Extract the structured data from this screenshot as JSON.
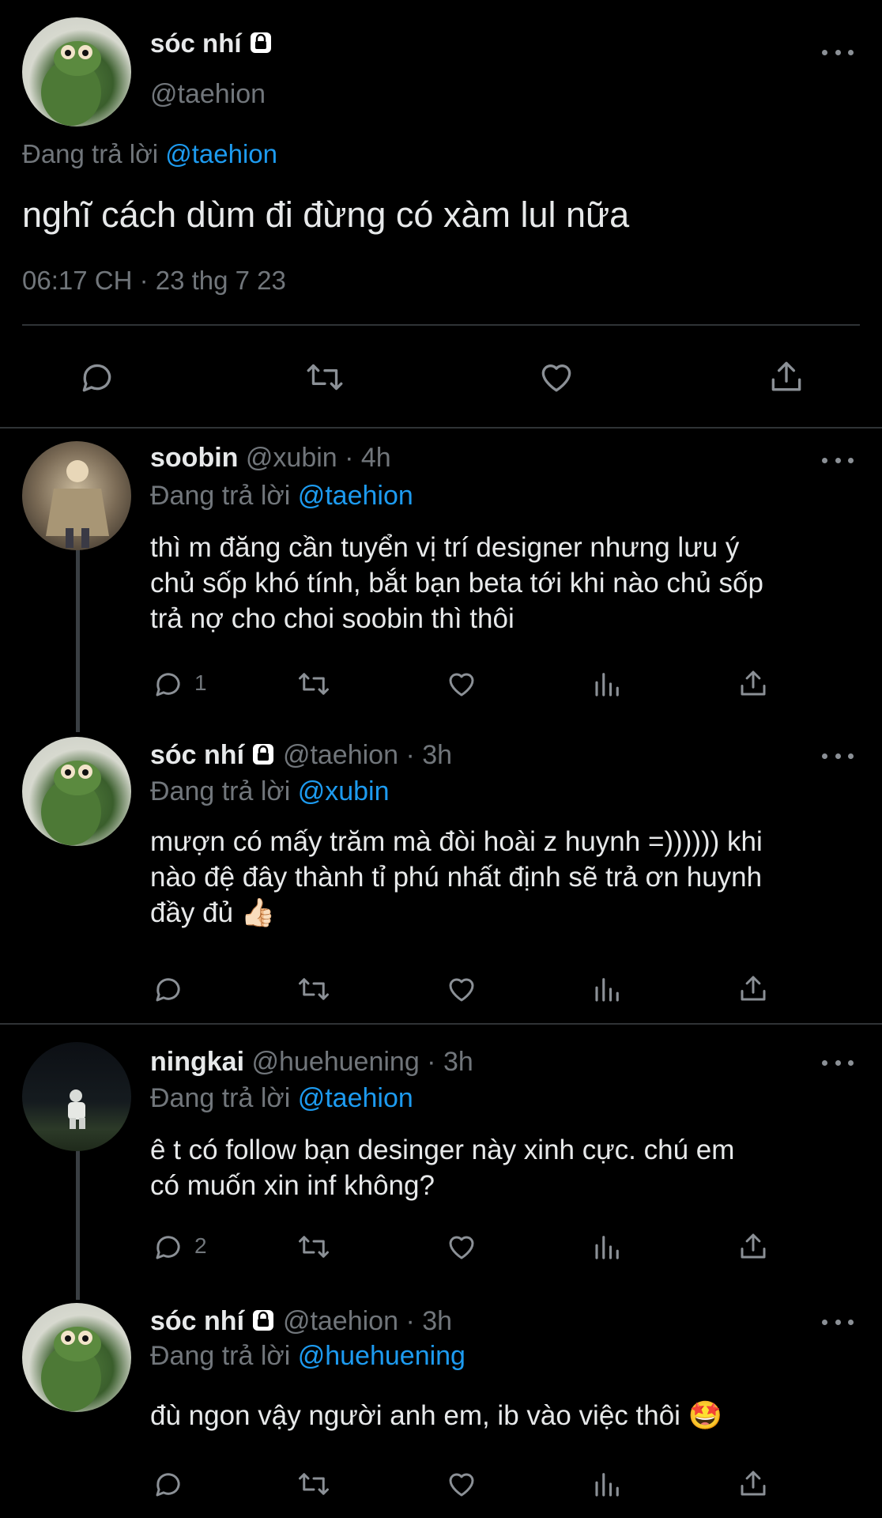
{
  "main_tweet": {
    "display_name": "sóc nhí",
    "handle": "@taehion",
    "replying_prefix": "Đang trả lời",
    "replying_to": "@taehion",
    "text": "nghĩ cách dùm đi đừng có xàm lul nữa",
    "timestamp": "06:17 CH · 23 thg 7 23"
  },
  "replies": [
    {
      "display_name": "soobin",
      "handle_time": "@xubin · 4h",
      "replying_prefix": "Đang trả lời",
      "replying_to": "@taehion",
      "lines": [
        "thì m đăng cần tuyển vị trí designer nhưng lưu ý",
        "chủ sốp khó tính, bắt bạn beta tới khi nào chủ sốp",
        "trả nợ cho choi soobin thì thôi"
      ],
      "reply_count": "1"
    },
    {
      "display_name": "sóc nhí",
      "handle_time": "@taehion · 3h",
      "replying_prefix": "Đang trả lời",
      "replying_to": "@xubin",
      "lines": [
        "mượn có mấy trăm mà đòi hoài z huynh =)))))) khi",
        "nào đệ đây thành tỉ phú nhất định sẽ trả ơn huynh",
        "đầy đủ 👍🏻"
      ],
      "reply_count": ""
    },
    {
      "display_name": "ningkai",
      "handle_time": "@huehuening · 3h",
      "replying_prefix": "Đang trả lời",
      "replying_to": "@taehion",
      "lines": [
        "ê t có follow bạn desinger này xinh cực. chú em",
        "có muốn xin inf không?"
      ],
      "reply_count": "2"
    },
    {
      "display_name": "sóc nhí",
      "handle_time": "@taehion · 3h",
      "replying_prefix": "Đang trả lời",
      "replying_to": "@huehuening",
      "lines": [
        "đù ngon vậy người anh em, ib vào việc thôi 🤩"
      ],
      "reply_count": ""
    }
  ],
  "icons": [
    "lock-icon",
    "more-icon",
    "reply-icon",
    "retweet-icon",
    "like-icon",
    "views-icon",
    "share-icon"
  ],
  "colors": {
    "background": "#000000",
    "text": "#e7e9ea",
    "muted": "#71767b",
    "link": "#1d9bf0",
    "divider": "#2f3336"
  }
}
